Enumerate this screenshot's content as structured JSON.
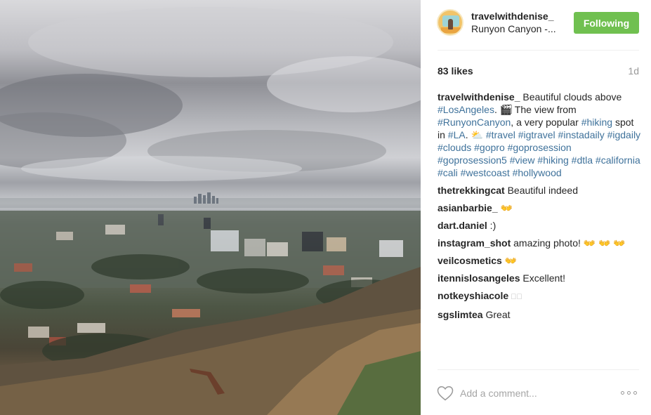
{
  "post": {
    "image_alt": "Cloudy view over Los Angeles from Runyon Canyon"
  },
  "header": {
    "username": "travelwithdenise_",
    "location": "Runyon Canyon -...",
    "follow_label": "Following"
  },
  "stats": {
    "likes": "83 likes",
    "time": "1d"
  },
  "caption": {
    "author": "travelwithdenise_",
    "t1": " Beautiful clouds above ",
    "tag_losangeles": "#LosAngeles",
    "t2": ". 🎬⃞ The view from ",
    "tag_runyon": "#RunyonCanyon",
    "t3": ", a very popular ",
    "tag_hiking": "#hiking",
    "t4": " spot in ",
    "tag_la": "#LA",
    "t5": ". ⛅ ",
    "tags_rest": "#travel #igtravel #instadaily #igdaily #clouds #gopro #goprosession #goprosession5 #view #hiking #dtla #california #cali #westcoast #hollywood"
  },
  "comments": [
    {
      "author": "thetrekkingcat",
      "text": " Beautiful indeed"
    },
    {
      "author": "asianbarbie_",
      "text": " 👐"
    },
    {
      "author": "dart.daniel",
      "text": " :)"
    },
    {
      "author": "instagram_shot",
      "text": " amazing photo! 👐 👐 👐"
    },
    {
      "author": "veilcosmetics",
      "text": " 👐"
    },
    {
      "author": "itennislosangeles",
      "text": " Excellent!"
    },
    {
      "author": "notkeyshiacole",
      "text": " ⃞⃞"
    },
    {
      "author": "sgslimtea",
      "text": " Great"
    }
  ],
  "footer": {
    "comment_placeholder": "Add a comment...",
    "icons": {
      "like": "heart-icon",
      "more": "more-options-icon"
    }
  },
  "colors": {
    "follow_green": "#70c050",
    "hashtag_blue": "#3f729b",
    "muted_gray": "#999999"
  }
}
